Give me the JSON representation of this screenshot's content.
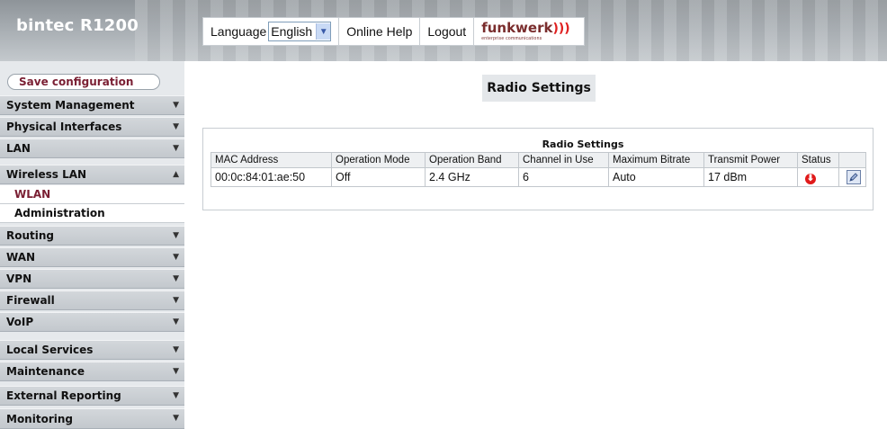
{
  "header": {
    "brand": "bintec R1200",
    "language_label": "Language",
    "language_value": "English",
    "online_help": "Online Help",
    "logout": "Logout",
    "logo_text": "funkwerk",
    "logo_subtitle": "enterprise communications"
  },
  "sidebar": {
    "save_label": "Save configuration",
    "items": [
      {
        "label": "System Management",
        "expanded": false
      },
      {
        "label": "Physical Interfaces",
        "expanded": false
      },
      {
        "label": "LAN",
        "expanded": false
      },
      {
        "label": "Wireless LAN",
        "expanded": true,
        "children": [
          {
            "label": "WLAN",
            "active": true
          },
          {
            "label": "Administration",
            "active": false
          }
        ]
      },
      {
        "label": "Routing",
        "expanded": false
      },
      {
        "label": "WAN",
        "expanded": false
      },
      {
        "label": "VPN",
        "expanded": false
      },
      {
        "label": "Firewall",
        "expanded": false
      },
      {
        "label": "VoIP",
        "expanded": false
      },
      {
        "label": "Local Services",
        "expanded": false
      },
      {
        "label": "Maintenance",
        "expanded": false
      },
      {
        "label": "External Reporting",
        "expanded": false
      },
      {
        "label": "Monitoring",
        "expanded": false
      }
    ]
  },
  "main": {
    "page_title": "Radio Settings",
    "table_title": "Radio Settings",
    "columns": [
      "MAC Address",
      "Operation Mode",
      "Operation Band",
      "Channel in Use",
      "Maximum Bitrate",
      "Transmit Power",
      "Status",
      ""
    ],
    "rows": [
      {
        "mac": "00:0c:84:01:ae:50",
        "mode": "Off",
        "band": "2.4 GHz",
        "channel": "6",
        "bitrate": "Auto",
        "power": "17 dBm",
        "status_icon": "down-arrow-red-icon",
        "action_icon": "edit-icon"
      }
    ]
  },
  "colors": {
    "brand_text": "#ffffff",
    "active_nav": "#7a1f33",
    "status_error": "#e01a1a",
    "logo_waves": "#e02020"
  }
}
